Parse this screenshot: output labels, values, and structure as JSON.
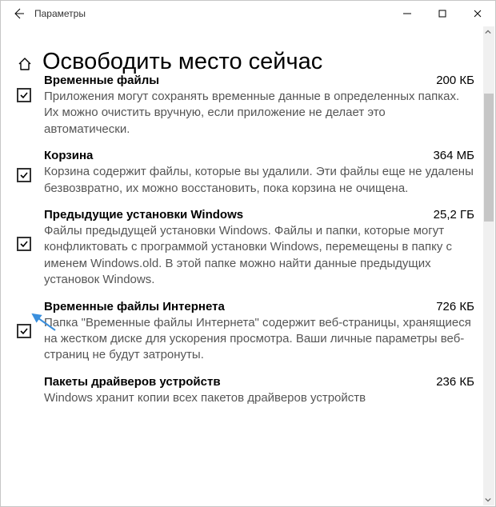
{
  "titlebar": {
    "title": "Параметры"
  },
  "page": {
    "title": "Освободить место сейчас"
  },
  "items": [
    {
      "title": "Временные файлы",
      "size": "200 КБ",
      "desc": "Приложения могут сохранять временные данные в определенных папках. Их можно очистить вручную, если приложение не делает это автоматически.",
      "checked": true
    },
    {
      "title": "Корзина",
      "size": "364 МБ",
      "desc": "Корзина содержит файлы, которые вы удалили. Эти файлы еще не удалены безвозвратно, их можно восстановить, пока корзина не очищена.",
      "checked": true
    },
    {
      "title": "Предыдущие установки Windows",
      "size": "25,2 ГБ",
      "desc": "Файлы предыдущей установки Windows.  Файлы и папки, которые могут конфликтовать с программой установки Windows, перемещены в папку с именем Windows.old.  В этой папке можно найти данные предыдущих установок Windows.",
      "checked": true
    },
    {
      "title": "Временные файлы Интернета",
      "size": "726 КБ",
      "desc": "Папка \"Временные файлы Интернета\" содержит веб-страницы, хранящиеся на жестком диске для ускорения просмотра. Ваши личные параметры веб-страниц не будут затронуты.",
      "checked": true
    },
    {
      "title": "Пакеты драйверов устройств",
      "size": "236 КБ",
      "desc": "Windows хранит копии всех пакетов драйверов устройств",
      "checked": true
    }
  ]
}
